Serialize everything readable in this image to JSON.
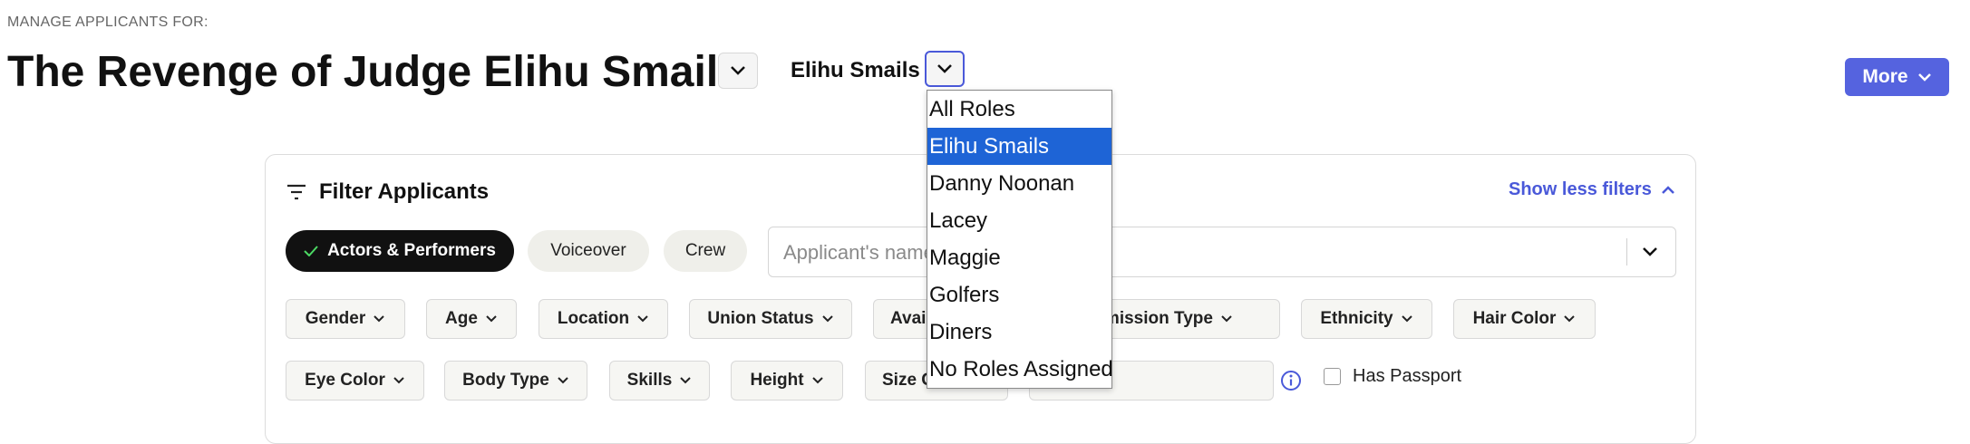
{
  "header": {
    "eyebrow": "MANAGE APPLICANTS FOR:",
    "project_title": "The Revenge of Judge Elihu Smails",
    "selected_role": "Elihu Smails",
    "more_label": "More"
  },
  "roles_dropdown": {
    "options": [
      "All Roles",
      "Elihu Smails",
      "Danny Noonan",
      "Lacey",
      "Maggie",
      "Golfers",
      "Diners",
      "No Roles Assigned"
    ],
    "selected": "Elihu Smails"
  },
  "filter_panel": {
    "heading": "Filter Applicants",
    "toggle_label": "Show less filters",
    "categories": [
      "Actors & Performers",
      "Voiceover",
      "Crew"
    ],
    "active_category": "Actors & Performers",
    "search_placeholder": "Applicant's name",
    "filter_row1": [
      "Gender",
      "Age",
      "Location",
      "Union Status",
      "Availability",
      "Submission Type",
      "Ethnicity",
      "Hair Color"
    ],
    "filter_row2": [
      "Eye Color",
      "Body Type",
      "Skills",
      "Height",
      "Size Category"
    ],
    "age_placeholder": "Skills",
    "has_passport_label": "Has Passport"
  },
  "colors": {
    "accent": "#5563df",
    "selected_option": "#1e64d6",
    "check": "#4cd964"
  }
}
